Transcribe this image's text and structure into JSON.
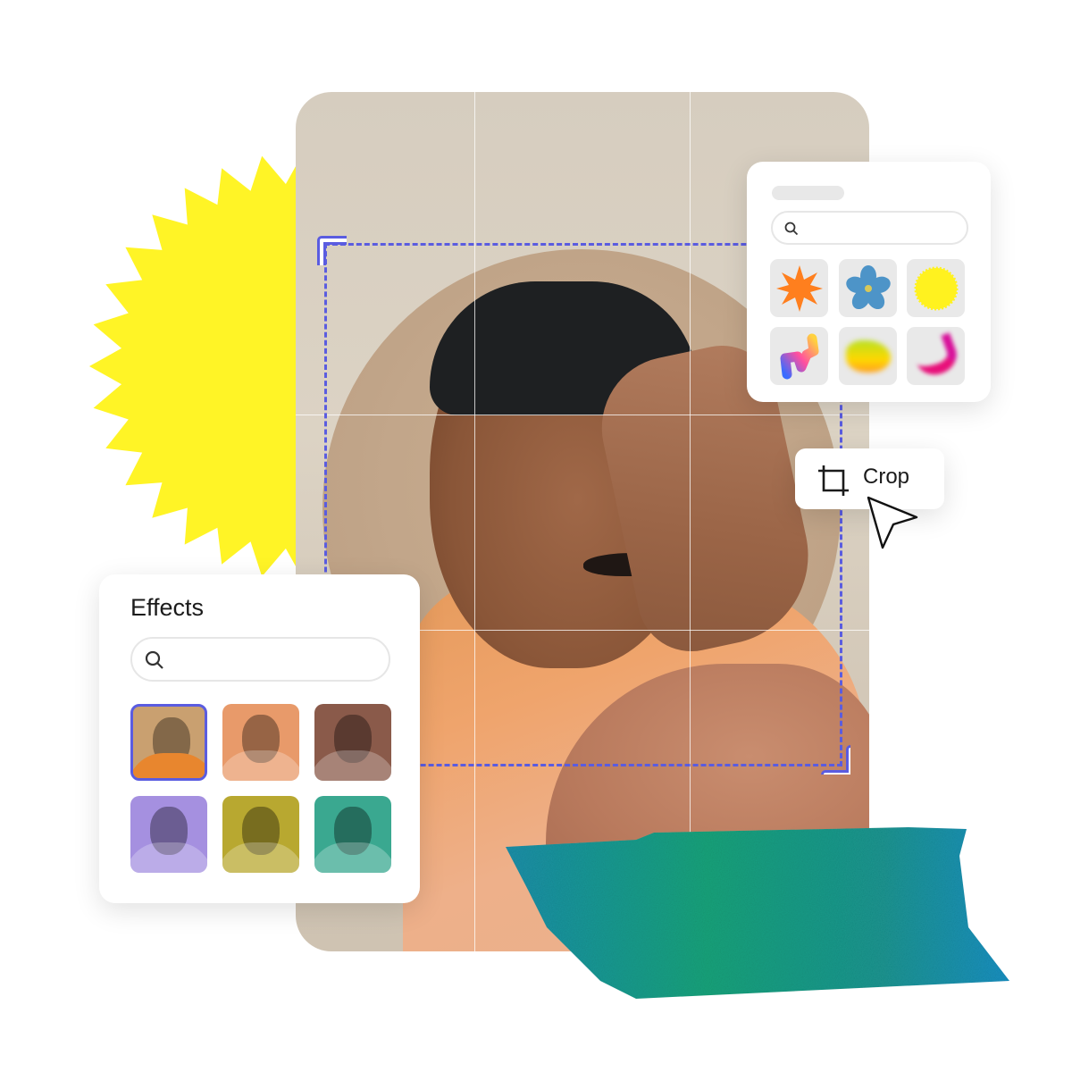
{
  "effects_panel": {
    "title": "Effects",
    "search": {
      "placeholder": "",
      "value": "",
      "icon": "search-icon"
    },
    "presets": [
      {
        "name": "original",
        "tint": "#c9a070",
        "selected": true
      },
      {
        "name": "pink-orange",
        "tint": "#e89a6a",
        "selected": false
      },
      {
        "name": "purple-brown",
        "tint": "#8a5a4a",
        "selected": false
      },
      {
        "name": "lavender",
        "tint": "#a590e0",
        "selected": false
      },
      {
        "name": "olive-gold",
        "tint": "#b8a830",
        "selected": false
      },
      {
        "name": "teal",
        "tint": "#3aa890",
        "selected": false
      }
    ],
    "selection_color": "#5a5ce0"
  },
  "stickers_panel": {
    "search": {
      "placeholder": "",
      "value": "",
      "icon": "search-icon"
    },
    "items": [
      {
        "name": "orange-starburst",
        "icon": "starburst-icon"
      },
      {
        "name": "blue-flower",
        "icon": "flower-icon"
      },
      {
        "name": "yellow-sun-seal",
        "icon": "sun-seal-icon"
      },
      {
        "name": "gradient-squiggle",
        "icon": "squiggle-icon"
      },
      {
        "name": "yellow-green-blob",
        "icon": "blob-icon"
      },
      {
        "name": "pink-crescent",
        "icon": "crescent-icon"
      }
    ]
  },
  "crop_tool": {
    "label": "Crop",
    "icon": "crop-icon",
    "frame_color": "#5a5ce0"
  },
  "colors": {
    "burst": "#fff426",
    "accent": "#5a5ce0"
  }
}
